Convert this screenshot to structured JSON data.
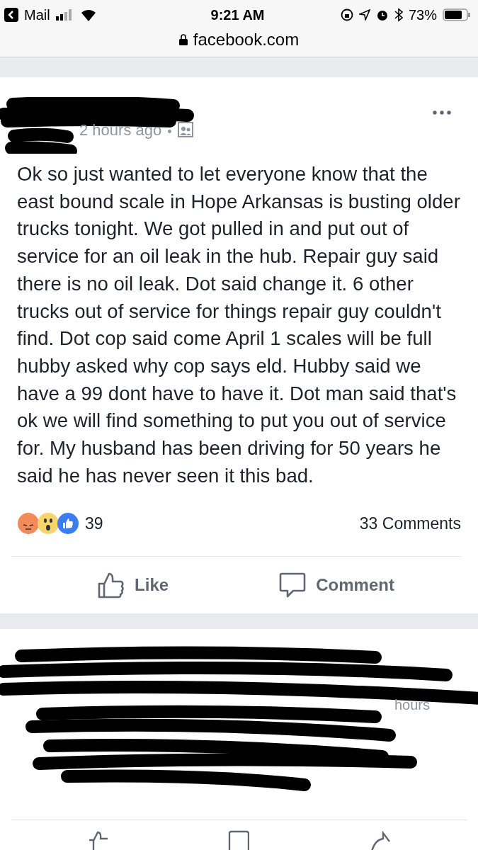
{
  "status_bar": {
    "back_label": "Mail",
    "time": "9:21 AM",
    "battery": "73%",
    "url": "facebook.com"
  },
  "posts": [
    {
      "kind": "full",
      "timestamp": "2 hours ago",
      "separator": "•",
      "body": "Ok so just wanted to let everyone know that the east bound scale in Hope Arkansas is busting older trucks tonight. We got pulled in and put out of service for an oil leak in the hub. Repair guy said there is no oil leak. Dot said change it. 6 other trucks out of service for things repair guy couldn't find. Dot cop said come April 1 scales will be full hubby asked why cop says eld. Hubby said we have a 99 dont have to have it. Dot man said that's ok we will find something to put you out of service for. My husband has been driving for 50 years he said he has never seen it this bad.",
      "reaction_count": "39",
      "comment_count": "33 Comments",
      "actions": [
        "Like",
        "Comment"
      ]
    },
    {
      "kind": "redacted",
      "timestamp": "hours"
    }
  ]
}
